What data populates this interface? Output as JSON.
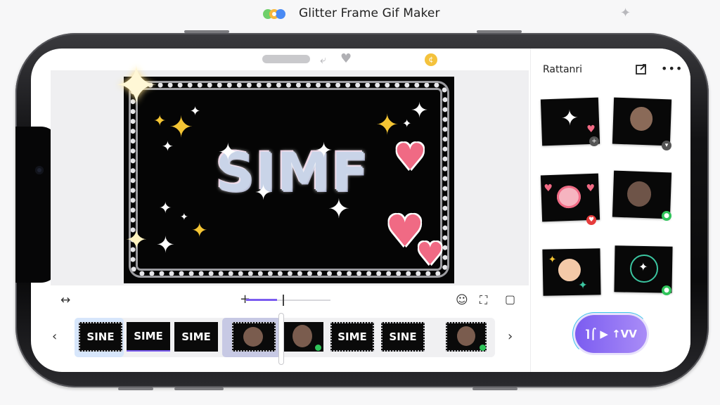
{
  "app": {
    "title": "Glitter Frame Gif Maker"
  },
  "preview": {
    "text": "SIMF"
  },
  "side_panel": {
    "title": "Rattanri"
  },
  "filmstrip": {
    "frames": [
      {
        "label": "SINE"
      },
      {
        "label": "SIME"
      },
      {
        "label": "SIME"
      },
      {
        "label": ""
      },
      {
        "label": ""
      },
      {
        "label": "SIME"
      },
      {
        "label": "SINE"
      },
      {
        "label": ""
      }
    ]
  },
  "export_button": {
    "label": "⌉⌠ ▶ ↑VV"
  },
  "icons": {
    "app_logo": "app-logo-icon",
    "sparkle": "sparkle-icon",
    "share": "share-icon",
    "more": "more-icon",
    "coin": "coin-icon",
    "resize": "resize-arrows-icon",
    "smiley": "emoji-icon",
    "crop": "crop-icon",
    "folder": "folder-icon",
    "chevron_left": "chevron-left-icon",
    "chevron_right": "chevron-right-icon",
    "heart": "heart-icon",
    "undo": "undo-icon"
  },
  "colors": {
    "accent": "#7b5cf0",
    "accent_ring": "#3bc5e8",
    "heart": "#f06a84",
    "gold": "#f4c534",
    "badge_green": "#2fc45a"
  }
}
